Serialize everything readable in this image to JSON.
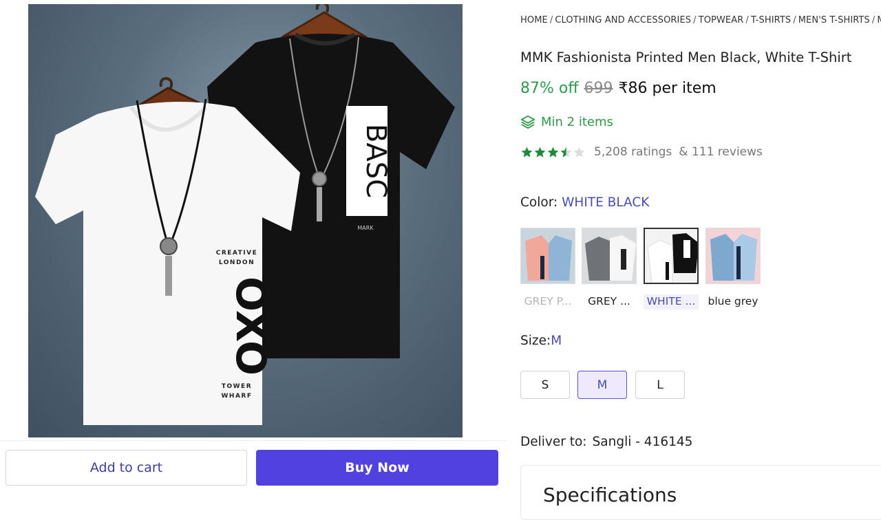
{
  "breadcrumb": [
    "HOME",
    "CLOTHING AND ACCESSORIES",
    "TOPWEAR",
    "T-SHIRTS",
    "MEN'S T-SHIRTS",
    "M"
  ],
  "product": {
    "title": "MMK Fashionista Printed Men Black, White T-Shirt",
    "discount": "87% off",
    "mrp": "699",
    "price": "₹86 per item",
    "min_items": "Min 2 items",
    "rating": 3.5,
    "ratings_text": "5,208 ratings",
    "reviews_text": "& 111 reviews"
  },
  "image_print": {
    "white_shirt_lines": [
      "CREATIVE",
      "LONDON",
      "TOWER",
      "WHARF"
    ],
    "white_shirt_logo": "OXO",
    "black_shirt_logo": "BASC",
    "black_shirt_tag": "MARK"
  },
  "color": {
    "label": "Color:",
    "selected": "WHITE BLACK",
    "options": [
      {
        "label": "GREY P...",
        "state": "unavailable"
      },
      {
        "label": "GREY ...",
        "state": "normal"
      },
      {
        "label": "WHITE ...",
        "state": "selected"
      },
      {
        "label": "blue grey",
        "state": "normal"
      }
    ]
  },
  "size": {
    "label": "Size:",
    "selected": "M",
    "options": [
      "S",
      "M",
      "L"
    ]
  },
  "delivery": {
    "label": "Deliver to:",
    "location": "Sangli - 416145"
  },
  "specifications": {
    "title": "Specifications"
  },
  "actions": {
    "add_to_cart": "Add to cart",
    "buy_now": "Buy Now"
  },
  "colors": {
    "accent": "#5142e0",
    "green": "#2e9b48",
    "selected_text": "#4b4bb0"
  }
}
